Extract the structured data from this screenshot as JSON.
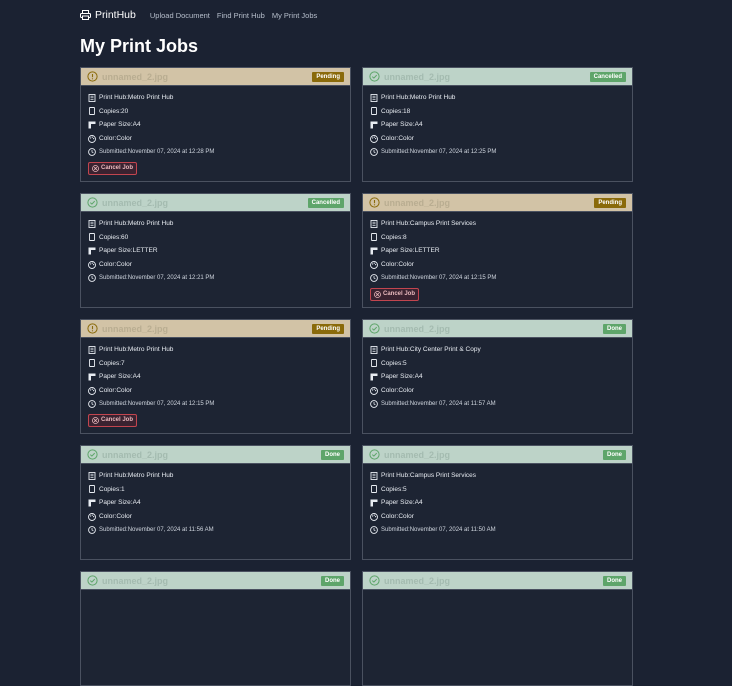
{
  "nav": {
    "brand": "PrintHub",
    "links": [
      "Upload Document",
      "Find Print Hub",
      "My Print Jobs"
    ]
  },
  "page": {
    "title": "My Print Jobs"
  },
  "labels": {
    "hub": "Print Hub: ",
    "copies": "Copies: ",
    "paper": "Paper Size: ",
    "color": "Color: ",
    "submitted": "Submitted: ",
    "cancel": "Cancel Job"
  },
  "colors": {
    "background": "#1b2232",
    "pending_header": "#d2c3a6",
    "done_header": "#bdd3c8",
    "pending_badge": "#8a6a0a",
    "done_badge": "#5ea56a",
    "cancel_border": "#c2454f"
  },
  "jobs": [
    {
      "file": "unnamed_2.jpg",
      "status": "Pending",
      "hub": "Metro Print Hub",
      "copies": "20",
      "paper": "A4",
      "color": "Color",
      "submitted": "November 07, 2024 at 12:28 PM",
      "icon": "alert-circle-icon",
      "cancel": true
    },
    {
      "file": "unnamed_2.jpg",
      "status": "Cancelled",
      "hub": "Metro Print Hub",
      "copies": "18",
      "paper": "A4",
      "color": "Color",
      "submitted": "November 07, 2024 at 12:25 PM",
      "icon": "check-circle-icon",
      "cancel": false
    },
    {
      "file": "unnamed_2.jpg",
      "status": "Cancelled",
      "hub": "Metro Print Hub",
      "copies": "60",
      "paper": "LETTER",
      "color": "Color",
      "submitted": "November 07, 2024 at 12:21 PM",
      "icon": "check-circle-icon",
      "cancel": false
    },
    {
      "file": "unnamed_2.jpg",
      "status": "Pending",
      "hub": "Campus Print Services",
      "copies": "8",
      "paper": "LETTER",
      "color": "Color",
      "submitted": "November 07, 2024 at 12:15 PM",
      "icon": "alert-circle-icon",
      "cancel": true
    },
    {
      "file": "unnamed_2.jpg",
      "status": "Pending",
      "hub": "Metro Print Hub",
      "copies": "7",
      "paper": "A4",
      "color": "Color",
      "submitted": "November 07, 2024 at 12:15 PM",
      "icon": "alert-circle-icon",
      "cancel": true
    },
    {
      "file": "unnamed_2.jpg",
      "status": "Done",
      "hub": "City Center Print & Copy",
      "copies": "5",
      "paper": "A4",
      "color": "Color",
      "submitted": "November 07, 2024 at 11:57 AM",
      "icon": "check-circle-icon",
      "cancel": false
    },
    {
      "file": "unnamed_2.jpg",
      "status": "Done",
      "hub": "Metro Print Hub",
      "copies": "1",
      "paper": "A4",
      "color": "Color",
      "submitted": "November 07, 2024 at 11:56 AM",
      "icon": "check-circle-icon",
      "cancel": false
    },
    {
      "file": "unnamed_2.jpg",
      "status": "Done",
      "hub": "Campus Print Services",
      "copies": "5",
      "paper": "A4",
      "color": "Color",
      "submitted": "November 07, 2024 at 11:50 AM",
      "icon": "check-circle-icon",
      "cancel": false
    },
    {
      "file": "unnamed_2.jpg",
      "status": "Done",
      "icon": "check-circle-icon",
      "cancel": false
    },
    {
      "file": "unnamed_2.jpg",
      "status": "Done",
      "icon": "check-circle-icon",
      "cancel": false
    }
  ]
}
